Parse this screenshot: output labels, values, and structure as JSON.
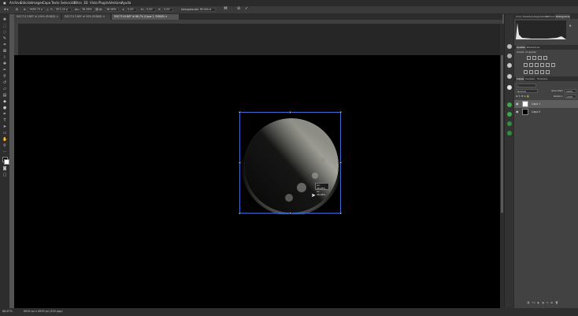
{
  "menu": [
    "Archivo",
    "Edición",
    "Imagen",
    "Capa",
    "Texto",
    "Selección",
    "Filtro",
    "3D",
    "Vista",
    "Plugins",
    "Ventana",
    "Ayuda"
  ],
  "options": {
    "x_label": "X:",
    "x_value": "1089,75 p",
    "y_label": "Y:",
    "y_value": "501,00 p",
    "w_label": "An:",
    "w_value": "38,98%",
    "h_label": "Al:",
    "h_value": "38,98%",
    "angle_value": "0,00",
    "hskew_label": "H:",
    "hskew_value": "0,00",
    "vskew_label": "V:",
    "vskew_value": "0,00",
    "interp_label": "Interpolación:",
    "interp_value": "Bicúbica",
    "cancel_icon": "cancel-icon",
    "commit_icon": "checkmark-icon"
  },
  "tabs": [
    {
      "label": "DSC7113.NEF al 100% (RGB/8) ×"
    },
    {
      "label": "DSC7113.NEF al 50% (RGB/8) ×"
    },
    {
      "label": "DSC7116.NEF al 66,7% (Capa 1, RGB/8) ×"
    }
  ],
  "tooltip": {
    "line1": "An: 38,98%",
    "line2": "Al: 38,98%"
  },
  "status": {
    "zoom": "66,67%",
    "doc_info": "6000 px x 4000 px (300 ppp)"
  },
  "panels": {
    "top_tabs": [
      "Color",
      "Muestras",
      "Degradados",
      "Motivos",
      "Histograma"
    ],
    "adj_tabs": [
      "Ajustes",
      "Bibliotecas"
    ],
    "adj_title": "Añadir un ajuste",
    "layer_tabs": [
      "Capas",
      "Canales",
      "Trazados"
    ],
    "blend_mode": "Normal",
    "opacity_label": "Opacidad:",
    "opacity_value": "100%",
    "fill_label": "Relleno:",
    "fill_value": "100%",
    "layers": [
      {
        "name": "Capa 1"
      },
      {
        "name": "Capa 0"
      }
    ]
  },
  "colors": {
    "transform_box": "#3e6ad6",
    "canvas_bg": "#000000",
    "ui_dark": "#2b2b2b"
  }
}
